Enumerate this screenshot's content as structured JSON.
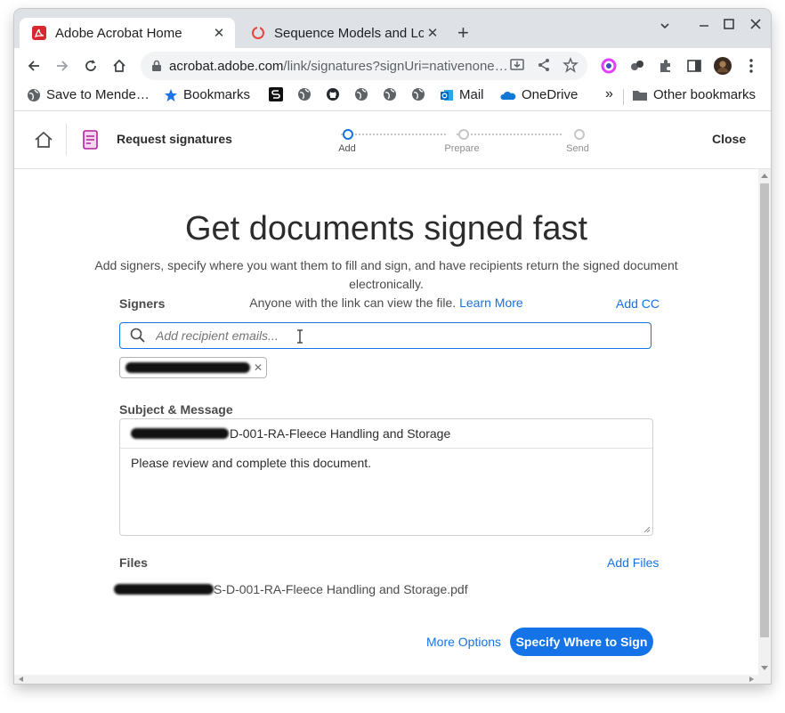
{
  "browser": {
    "tabs": [
      {
        "title": "Adobe Acrobat Home",
        "favicon": "acrobat-icon",
        "active": true
      },
      {
        "title": "Sequence Models and Lon",
        "favicon": "coursera-icon",
        "active": false
      }
    ],
    "new_tab": "+",
    "url_host": "acrobat.adobe.com",
    "url_path": "/link/signatures?signUri=nativenone…",
    "bookmarks": [
      {
        "label": "Save to Mende…",
        "icon": "globe-icon"
      },
      {
        "label": "Bookmarks",
        "icon": "star-icon"
      },
      {
        "label": "Mail",
        "icon": "outlook-icon"
      },
      {
        "label": "OneDrive",
        "icon": "onedrive-icon"
      }
    ],
    "bookmarks_overflow": "»",
    "other_bookmarks": "Other bookmarks"
  },
  "app": {
    "title": "Request signatures",
    "close_label": "Close",
    "steps": [
      "Add",
      "Prepare",
      "Send"
    ],
    "accent": "#1473e6"
  },
  "main": {
    "heading": "Get documents signed fast",
    "subtitle_line1": "Add signers, specify where you want them to fill and sign, and have recipients return the signed document electronically.",
    "subtitle_line2": "Anyone with the link can view the file.",
    "learn_more": "Learn More",
    "signers_label": "Signers",
    "add_cc": "Add CC",
    "recipient_placeholder": "Add recipient emails...",
    "subject_label": "Subject & Message",
    "subject_suffix": "D-001-RA-Fleece Handling and Storage",
    "message": "Please review and complete this document.",
    "files_label": "Files",
    "add_files": "Add Files",
    "file_suffix": "S-D-001-RA-Fleece Handling and Storage.pdf",
    "more_options": "More Options",
    "specify_button": "Specify Where to Sign"
  }
}
